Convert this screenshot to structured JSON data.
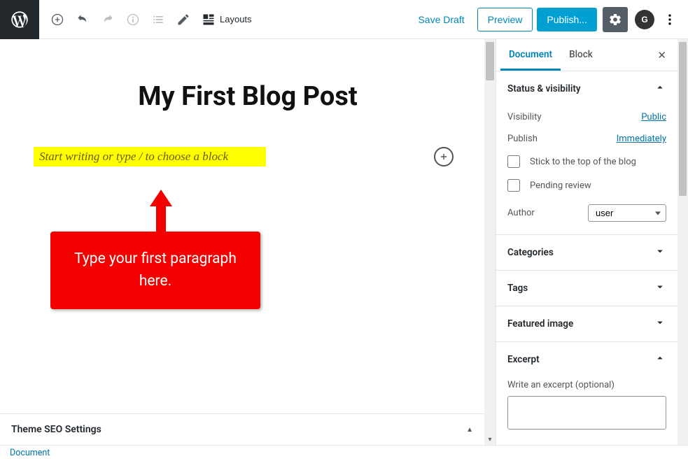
{
  "toolbar": {
    "layouts_label": "Layouts",
    "save_draft": "Save Draft",
    "preview": "Preview",
    "publish": "Publish...",
    "grav_initial": "G"
  },
  "editor": {
    "title": "My First Blog Post",
    "block_placeholder": "Start writing or type / to choose a block"
  },
  "annotation": {
    "callout_text": "Type your first paragraph here."
  },
  "seo_panel": {
    "title": "Theme SEO Settings"
  },
  "sidebar": {
    "tabs": {
      "document": "Document",
      "block": "Block"
    },
    "status": {
      "heading": "Status & visibility",
      "visibility_label": "Visibility",
      "visibility_value": "Public",
      "publish_label": "Publish",
      "publish_value": "Immediately",
      "sticky_label": "Stick to the top of the blog",
      "pending_label": "Pending review",
      "author_label": "Author",
      "author_value": "user"
    },
    "sections": {
      "categories": "Categories",
      "tags": "Tags",
      "featured": "Featured image",
      "excerpt": "Excerpt"
    },
    "excerpt_hint": "Write an excerpt (optional)"
  },
  "footer": {
    "breadcrumb": "Document"
  }
}
